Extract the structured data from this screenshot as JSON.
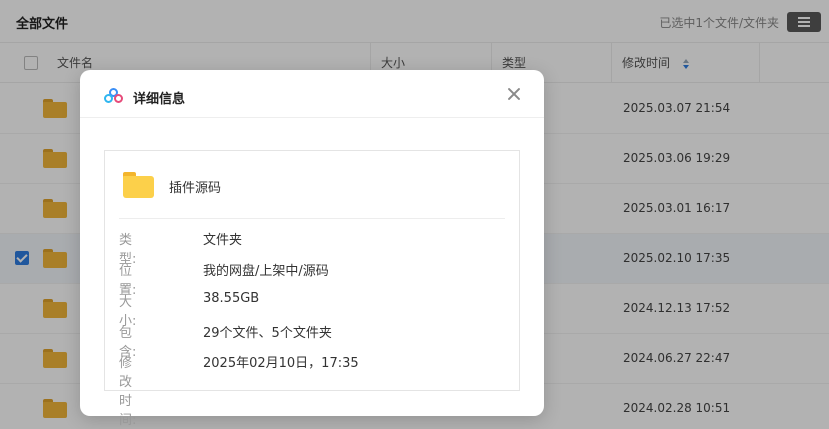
{
  "topbar": {
    "title": "全部文件",
    "selection_status": "已选中1个文件/文件夹"
  },
  "table": {
    "columns": {
      "name": "文件名",
      "size": "大小",
      "type": "类型",
      "modified": "修改时间"
    },
    "rows": [
      {
        "modified": "2025.03.07 21:54",
        "selected": false
      },
      {
        "modified": "2025.03.06 19:29",
        "selected": false
      },
      {
        "modified": "2025.03.01 16:17",
        "selected": false
      },
      {
        "modified": "2025.02.10 17:35",
        "selected": true
      },
      {
        "modified": "2024.12.13 17:52",
        "selected": false
      },
      {
        "modified": "2024.06.27 22:47",
        "selected": false
      },
      {
        "modified": "2024.02.28 10:51",
        "selected": false
      }
    ]
  },
  "dialog": {
    "title": "详细信息",
    "file_name": "插件源码",
    "fields": [
      {
        "label": "类型:",
        "value": "文件夹"
      },
      {
        "label": "位置:",
        "value": "我的网盘/上架中/源码"
      },
      {
        "label": "大小:",
        "value": "38.55GB"
      },
      {
        "label": "包含:",
        "value": "29个文件、5个文件夹"
      },
      {
        "label": "修改时间:",
        "value": "2025年02月10日，17:35"
      }
    ]
  },
  "colors": {
    "accent": "#2f7de1",
    "folder": "#f2b73a"
  }
}
